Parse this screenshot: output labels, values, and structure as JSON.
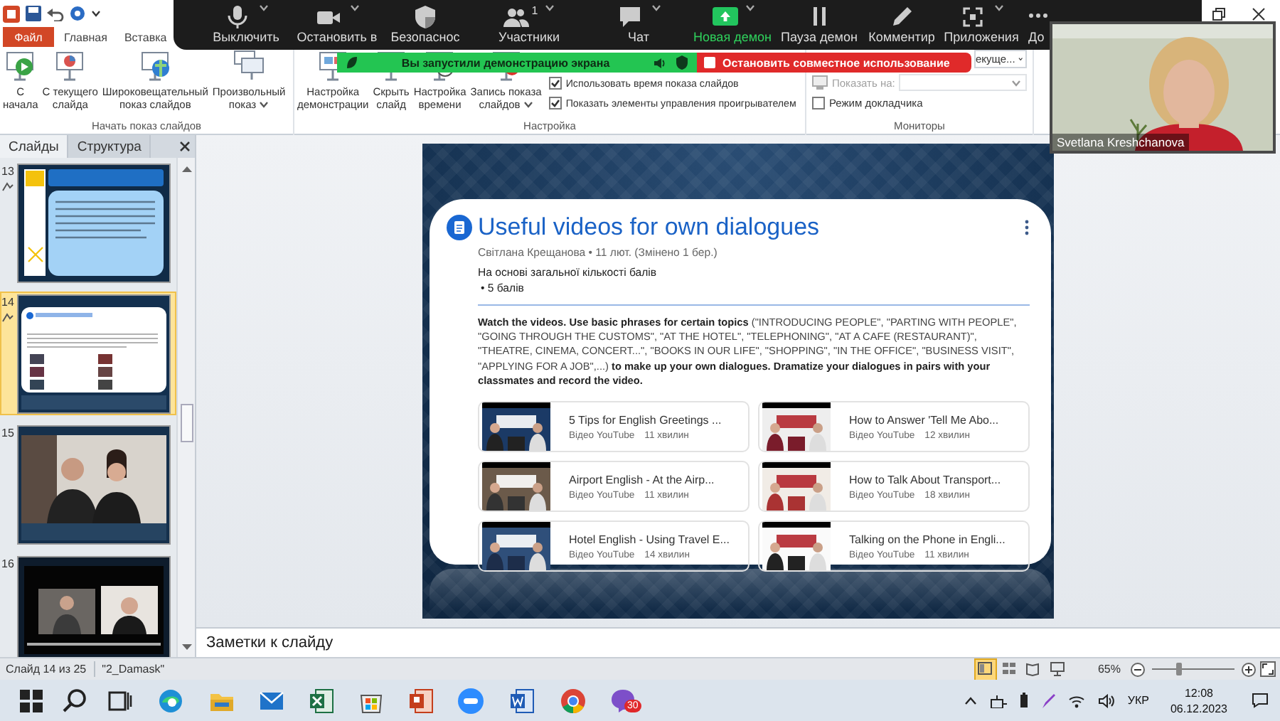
{
  "ribbon": {
    "tabs": [
      {
        "label": "Файл",
        "kind": "file"
      },
      {
        "label": "Главная",
        "kind": "tab"
      },
      {
        "label": "Вставка",
        "kind": "tab"
      }
    ],
    "groups": [
      {
        "label": "Начать показ слайдов",
        "buttons": [
          {
            "label": "С\nначала",
            "kind": "play",
            "dropdown": false
          },
          {
            "label": "С текущего\nслайда",
            "kind": "chart",
            "dropdown": false
          },
          {
            "label": "Широковещательный\nпоказ слайдов",
            "kind": "globe",
            "dropdown": false
          },
          {
            "label": "Произвольный\nпоказ",
            "kind": "screens",
            "dropdown": true
          }
        ]
      },
      {
        "label": "Настройка",
        "buttons": [
          {
            "label": "Настройка\nдемонстрации",
            "kind": "setup",
            "dropdown": false
          },
          {
            "label": "Скрыть\nслайд",
            "kind": "hide",
            "dropdown": false
          },
          {
            "label": "Настройка\nвремени",
            "kind": "timer",
            "dropdown": false
          },
          {
            "label": "Запись показа\nслайдов",
            "kind": "record",
            "dropdown": true
          }
        ],
        "checks": [
          {
            "label": "Использовать время показа слайдов",
            "checked": true
          },
          {
            "label": "Показать элементы управления проигрывателем",
            "checked": true
          }
        ]
      },
      {
        "label": "Мониторы",
        "dropdown_value": "екуще...",
        "show_on": {
          "label": "Показать на:",
          "disabled": true
        },
        "checks": [
          {
            "label": "Режим докладчика",
            "checked": false
          }
        ]
      }
    ]
  },
  "meeting_toolbar": {
    "items": [
      {
        "label": "Выключить",
        "kind": "mic",
        "menu": true,
        "active": false
      },
      {
        "label": "Остановить в",
        "kind": "camera",
        "menu": true,
        "active": false
      },
      {
        "label": "Безопаснос",
        "kind": "shield",
        "menu": false,
        "active": false
      },
      {
        "label": "Участники",
        "kind": "people",
        "menu": true,
        "active": false,
        "count": "1"
      },
      {
        "label": "Чат",
        "kind": "chat",
        "menu": true,
        "active": false
      },
      {
        "label": "Новая демон",
        "kind": "share",
        "menu": true,
        "active": true
      },
      {
        "label": "Пауза демон",
        "kind": "pause",
        "menu": false,
        "active": false
      },
      {
        "label": "Комментир",
        "kind": "pen",
        "menu": false,
        "active": false
      },
      {
        "label": "Приложения",
        "kind": "apps",
        "menu": true,
        "active": false
      },
      {
        "label": "До",
        "kind": "more",
        "menu": false,
        "active": false
      }
    ]
  },
  "share_banner": {
    "message": "Вы запустили демонстрацию экрана",
    "stop_label": "Остановить совместное использование"
  },
  "camera": {
    "name": "Svetlana Kreshchanova"
  },
  "slides_panel": {
    "tabs": [
      {
        "label": "Слайды",
        "selected": true
      },
      {
        "label": "Структура",
        "selected": false
      }
    ],
    "slides": [
      {
        "number": "13",
        "kind": "text-slide",
        "animated": true,
        "selected": false
      },
      {
        "number": "14",
        "kind": "post-slide",
        "animated": true,
        "selected": true
      },
      {
        "number": "15",
        "animated": false,
        "selected": false
      },
      {
        "number": "16",
        "kind": "video-call",
        "animated": false,
        "selected": false
      }
    ]
  },
  "slide": {
    "post": {
      "title": "Useful videos for own dialogues",
      "meta": "Світлана Крещанова • 11 лют. (Змінено 1 бер.)",
      "grading": "На основі загальної кількості балів",
      "points": "• 5 балів",
      "body": "**Watch the videos. Use basic phrases for certain topics** (\"INTRODUCING PEOPLE\", \"PARTING WITH PEOPLE\", \"GOING THROUGH THE CUSTOMS\", \"AT THE HOTEL\", \"TELEPHONING\", \"AT A CAFE (RESTAURANT)\", \"THEATRE, CINEMA, CONCERT...\", \"BOOKS IN OUR LIFE\", \"SHOPPING\", \"IN THE OFFICE\", \"BUSINESS VISIT\", \"APPLYING FOR A JOB\",...) **to make up your own dialogues. Dramatize your dialogues in pairs with your classmates and record the video.**",
      "videos": [
        {
          "title": "5 Tips for English Greetings ...",
          "source": "Відео YouTube",
          "duration": "11 хвилин"
        },
        {
          "title": "How to Answer 'Tell Me Abo...",
          "source": "Відео YouTube",
          "duration": "12 хвилин"
        },
        {
          "title": "Airport English - At the Airp...",
          "source": "Відео YouTube",
          "duration": "11 хвилин"
        },
        {
          "title": "How to Talk About Transport...",
          "source": "Відео YouTube",
          "duration": "18 хвилин"
        },
        {
          "title": "Hotel English - Using Travel E...",
          "source": "Відео YouTube",
          "duration": "14 хвилин"
        },
        {
          "title": "Talking on the Phone in Engli...",
          "source": "Відео YouTube",
          "duration": "11 хвилин"
        }
      ]
    }
  },
  "notes": {
    "placeholder": "Заметки к слайду"
  },
  "status_bar": {
    "slide": "Слайд 14 из 25",
    "theme": "\"2_Damask\"",
    "views": [
      {
        "kind": "normal",
        "selected": true
      },
      {
        "kind": "sorter",
        "selected": false
      },
      {
        "kind": "reading",
        "selected": false
      },
      {
        "kind": "show",
        "selected": false
      }
    ],
    "zoom": "65%",
    "level": 0.32
  },
  "taskbar": {
    "apps": [
      {
        "kind": "start"
      },
      {
        "kind": "search"
      },
      {
        "kind": "task-view"
      },
      {
        "kind": "wave-browser"
      },
      {
        "kind": "folder"
      },
      {
        "kind": "mail"
      },
      {
        "kind": "spreadsheet"
      },
      {
        "kind": "store"
      },
      {
        "kind": "presentation"
      },
      {
        "kind": "meeting"
      },
      {
        "kind": "document"
      },
      {
        "kind": "ring-browser"
      },
      {
        "kind": "messenger",
        "badge": "30"
      }
    ],
    "tray": {
      "language": "УКР",
      "time": "12:08",
      "date": "06.12.2023"
    }
  }
}
